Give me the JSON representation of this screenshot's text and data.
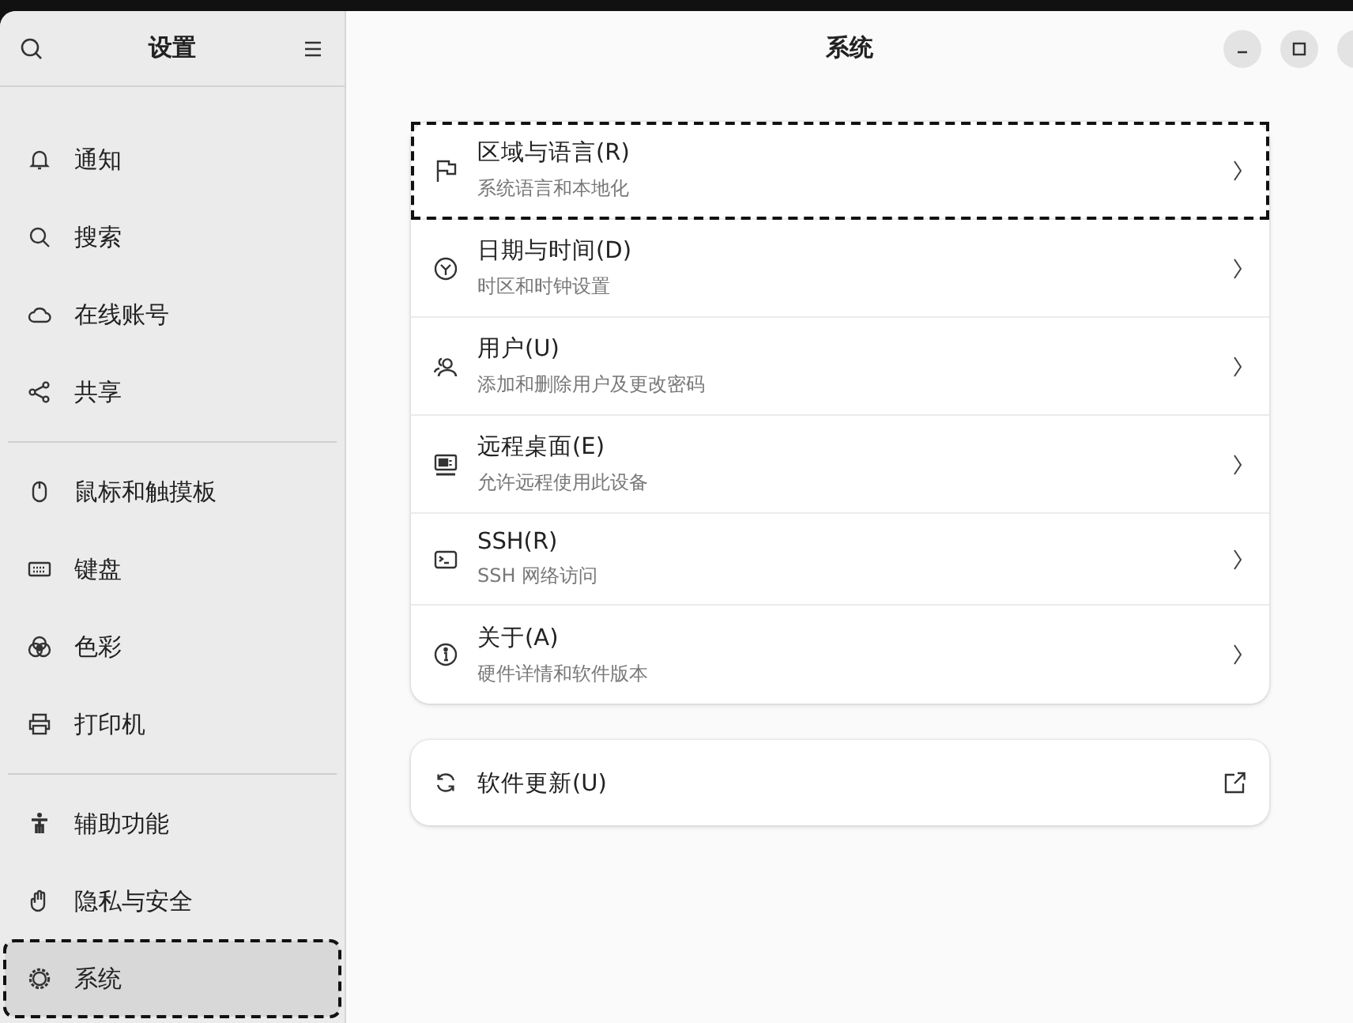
{
  "sidebar": {
    "title": "设置",
    "groups": [
      {
        "items": [
          {
            "label": "通知",
            "selected": false,
            "focused": false
          },
          {
            "label": "搜索",
            "selected": false,
            "focused": false
          },
          {
            "label": "在线账号",
            "selected": false,
            "focused": false
          },
          {
            "label": "共享",
            "selected": false,
            "focused": false
          }
        ]
      },
      {
        "items": [
          {
            "label": "鼠标和触摸板",
            "selected": false,
            "focused": false
          },
          {
            "label": "键盘",
            "selected": false,
            "focused": false
          },
          {
            "label": "色彩",
            "selected": false,
            "focused": false
          },
          {
            "label": "打印机",
            "selected": false,
            "focused": false
          }
        ]
      },
      {
        "items": [
          {
            "label": "辅助功能",
            "selected": false,
            "focused": false
          },
          {
            "label": "隐私与安全",
            "selected": false,
            "focused": false
          },
          {
            "label": "系统",
            "selected": true,
            "focused": true
          }
        ]
      }
    ]
  },
  "main": {
    "title": "系统",
    "rows": [
      {
        "title": "区域与语言(R)",
        "subtitle": "系统语言和本地化",
        "focused": true
      },
      {
        "title": "日期与时间(D)",
        "subtitle": "时区和时钟设置",
        "focused": false
      },
      {
        "title": "用户(U)",
        "subtitle": "添加和删除用户及更改密码",
        "focused": false
      },
      {
        "title": "远程桌面(E)",
        "subtitle": "允许远程使用此设备",
        "focused": false
      },
      {
        "title": "SSH(R)",
        "subtitle": "SSH 网络访问",
        "focused": false
      },
      {
        "title": "关于(A)",
        "subtitle": "硬件详情和软件版本",
        "focused": false
      }
    ],
    "update": {
      "title": "软件更新(U)"
    }
  }
}
